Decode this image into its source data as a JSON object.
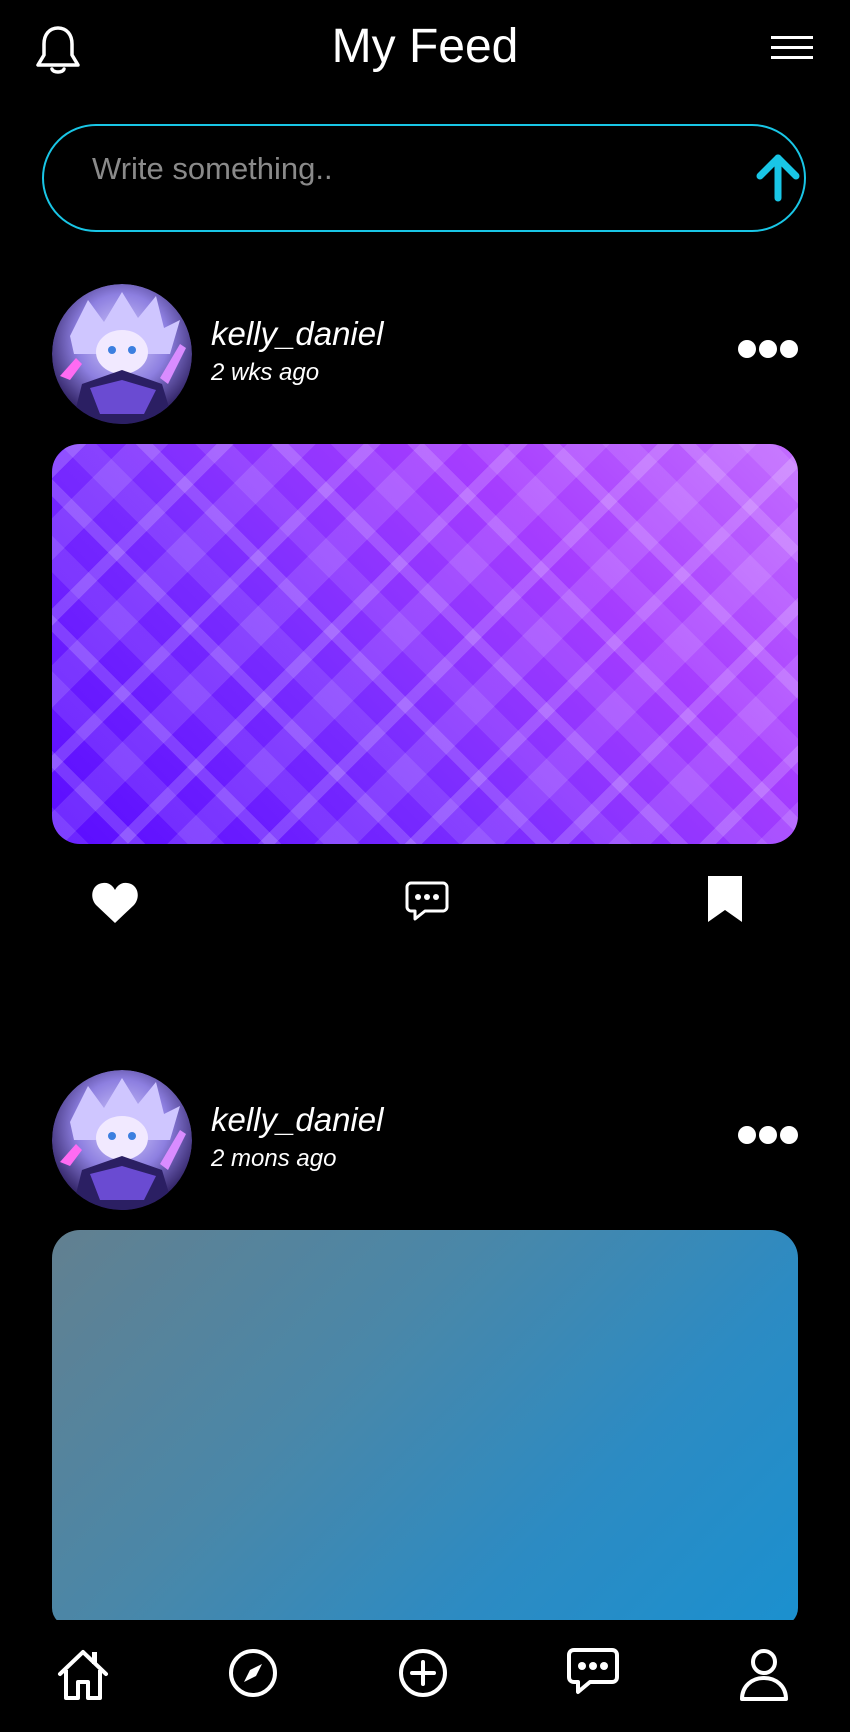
{
  "header": {
    "title": "My Feed",
    "left_icon": "bell-icon",
    "right_icon": "hamburger-menu-icon"
  },
  "composer": {
    "placeholder": "Write something..",
    "value": "",
    "send_icon": "arrow-up-icon",
    "accent_color": "#19c6e6"
  },
  "posts": [
    {
      "username": "kelly_daniel",
      "time_ago": "2 wks ago",
      "avatar_icon": "avatar-image",
      "more_icon": "more-dots-icon",
      "media_style": "purple-diamond-pattern",
      "actions": {
        "like_icon": "heart-icon",
        "comment_icon": "comment-bubble-icon",
        "save_icon": "bookmark-icon"
      }
    },
    {
      "username": "kelly_daniel",
      "time_ago": "2 mons ago",
      "avatar_icon": "avatar-image",
      "more_icon": "more-dots-icon",
      "media_style": "blue-gray-gradient"
    }
  ],
  "bottom_nav": [
    {
      "icon": "home-icon"
    },
    {
      "icon": "compass-icon"
    },
    {
      "icon": "plus-circle-icon"
    },
    {
      "icon": "chat-bubble-icon"
    },
    {
      "icon": "user-icon"
    }
  ]
}
